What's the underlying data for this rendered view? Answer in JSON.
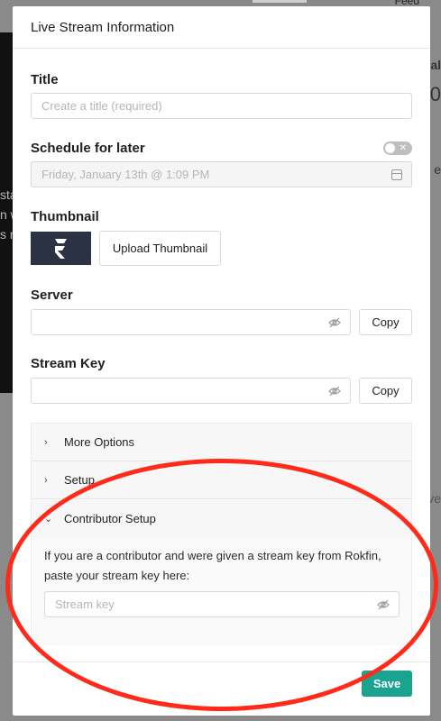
{
  "background": {
    "feed_label": "Feed",
    "side_fragments": [
      "al",
      "0",
      "sta",
      "n w",
      "s n",
      "e",
      "ve"
    ]
  },
  "modal": {
    "title": "Live Stream Information",
    "title_section": {
      "label": "Title",
      "placeholder": "Create a title (required)"
    },
    "schedule": {
      "label": "Schedule for later",
      "toggle_on": false,
      "toggle_off_glyph": "✕",
      "date_value": "Friday, January 13th @ 1:09 PM"
    },
    "thumbnail": {
      "label": "Thumbnail",
      "upload_label": "Upload Thumbnail"
    },
    "server": {
      "label": "Server",
      "copy_label": "Copy"
    },
    "stream_key": {
      "label": "Stream Key",
      "copy_label": "Copy"
    },
    "panels": [
      {
        "label": "More Options",
        "expanded": false,
        "chevron": "›"
      },
      {
        "label": "Setup",
        "expanded": false,
        "chevron": "›"
      },
      {
        "label": "Contributor Setup",
        "expanded": true,
        "chevron": "⌄"
      }
    ],
    "contributor": {
      "text": "If you are a contributor and were given a stream key from Rokfin, paste your stream key here:",
      "placeholder": "Stream key"
    },
    "save_label": "Save"
  },
  "colors": {
    "accent": "#1aa38f",
    "annotation": "#ff2a1a",
    "thumbnail_bg": "#2a3244"
  }
}
